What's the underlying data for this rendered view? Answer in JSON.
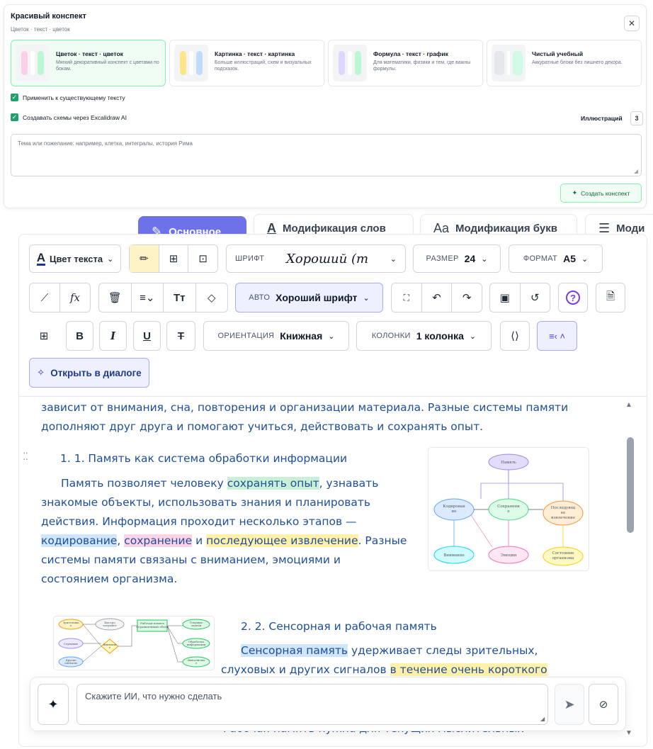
{
  "dialog": {
    "title": "Красивый конспект",
    "subtitle": "Цветок · текст · цветок",
    "close": "✕",
    "templates": [
      {
        "name": "Цветок · текст · цветок",
        "desc": "Мягкий декоративный конспект с цветами по бокам."
      },
      {
        "name": "Картинка · текст · картинка",
        "desc": "Больше иллюстраций, схем и визуальных подсказок."
      },
      {
        "name": "Формула · текст · график",
        "desc": "Для математики, физики и тем, где важны формулы."
      },
      {
        "name": "Чистый учебный",
        "desc": "Аккуратные блоки без лишнего декора."
      }
    ],
    "apply_existing": "Применить к существующему тексту",
    "excalidraw": "Создавать схемы через Excalidraw AI",
    "illustrations_label": "Иллюстраций",
    "illustrations_value": "3",
    "prompt_placeholder": "Тема или пожелание: например, клетка, интегралы, история Рима",
    "create_button": "Создать конспект"
  },
  "tabs": [
    {
      "label": "Основное"
    },
    {
      "label": "Модификация слов"
    },
    {
      "label": "Модификация букв"
    },
    {
      "label": "Моди"
    }
  ],
  "toolbar": {
    "text_color": "Цвет текста",
    "font_label": "ШРИФТ",
    "font_value": "Хороший (т",
    "size_label": "РАЗМЕР",
    "size_value": "24",
    "format_label": "ФОРМАТ",
    "format_value": "A5",
    "auto_label": "АВТО",
    "auto_value": "Хороший шрифт",
    "bold": "B",
    "italic": "I",
    "underline": "U",
    "orientation_label": "ОРИЕНТАЦИЯ",
    "orientation_value": "Книжная",
    "columns_label": "КОЛОНКИ",
    "columns_value": "1 колонка",
    "open_dialog": "Открыть в диалоге",
    "help": "?"
  },
  "document": {
    "intro": "зависит от внимания, сна, повторения и организации материала. Разные системы памяти дополняют друг друга и помогают учиться, действовать и сохранять опыт.",
    "s1_title": "1. 1. Память как система обработки информации",
    "s1_p_a": "Память позволяет человеку ",
    "s1_h1": "сохранять опыт",
    "s1_p_b": ", узнавать знакомые объекты, использовать знания и планировать действия. Информация проходит несколько этапов — ",
    "s1_h2": "кодирование",
    "s1_p_c": ", ",
    "s1_h3": "сохранение",
    "s1_p_d": " и ",
    "s1_h4": "последующее извлечение",
    "s1_p_e": ". Разные системы памяти связаны с вниманием, эмоциями и состоянием организма.",
    "s2_title": "2. 2. Сенсорная и рабочая память",
    "s2_h1": "Сенсорная память",
    "s2_p_a": " удерживает следы зрительных, слуховых и других сигналов ",
    "s2_h2": "в течение очень короткого",
    "s2_tail": "Рабочая память нужна для текущих мыслительных",
    "fig1": {
      "top": "Память",
      "left": "Кодирован ие",
      "center": "Сохранени е",
      "right": "Последующ ее извлечение",
      "b1": "Внимание",
      "b2": "Эмоции",
      "b3": "Состояние организма"
    },
    "fig2": {
      "a": "Зрительны е",
      "b": "Слуховые",
      "c": "Другие сигналы",
      "d": "Быстро затухают",
      "e": "Внимани е",
      "f": "Рабочая память Ограниченный объём",
      "g": "Текущие задачи",
      "h": "Обработка информации",
      "i": "Выполнени е"
    }
  },
  "ai": {
    "placeholder": "Скажите ИИ, что нужно сделать"
  },
  "colors": {
    "accent": "#6d72e8",
    "green": "#22a06b",
    "doc_text": "#1f4e9a"
  }
}
